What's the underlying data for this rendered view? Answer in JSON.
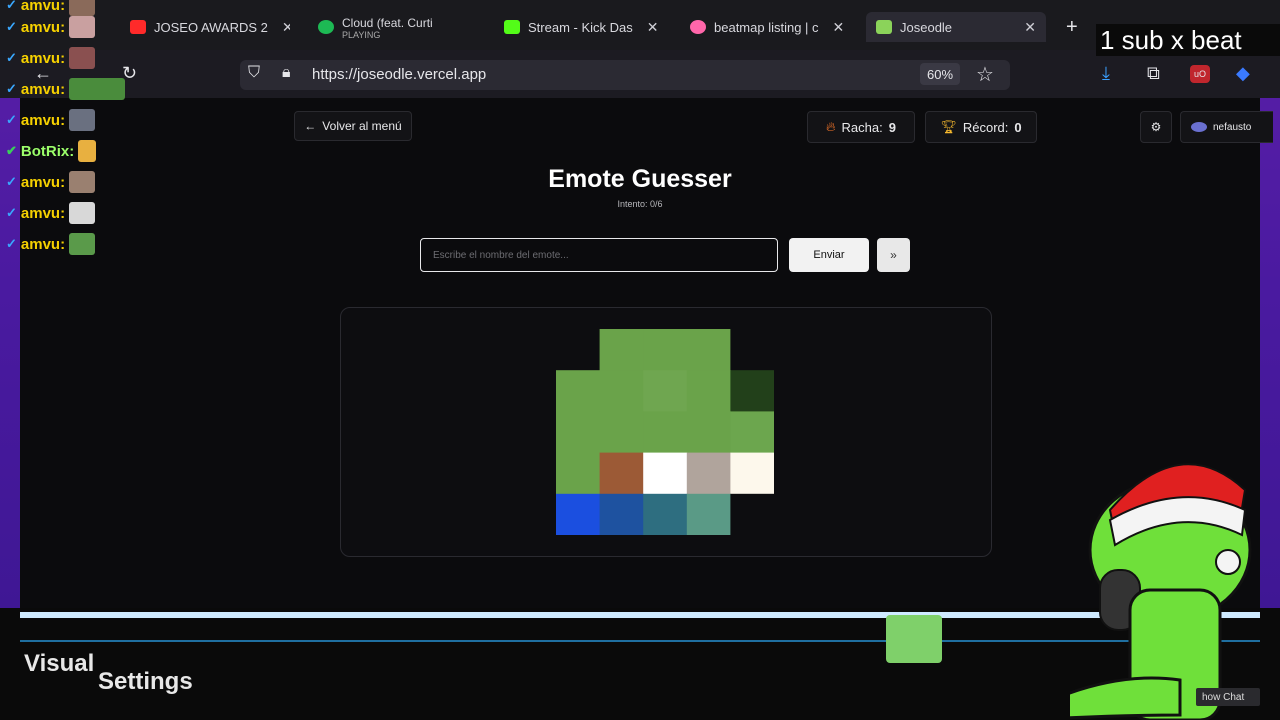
{
  "browser": {
    "tabs": [
      {
        "label": "JOSEO AWARDS 2",
        "favicon_color": "#ff2a2a"
      },
      {
        "label": "Cloud (feat. Curti",
        "sublabel": "PLAYING",
        "favicon_color": "#1db954"
      },
      {
        "label": "Stream - Kick Das",
        "favicon_color": "#53fc18"
      },
      {
        "label": "beatmap listing | c",
        "favicon_color": "#ff66aa"
      },
      {
        "label": "Joseodle",
        "favicon_color": "#8bd35a"
      }
    ],
    "url": "https://joseodle.vercel.app",
    "zoom": "60%"
  },
  "stream_overlay": {
    "banner_text": "1 sub x beat",
    "chat": [
      {
        "user": "amvu:",
        "emote_color": "#8a6a5a"
      },
      {
        "user": "amvu:",
        "emote_color": "#c9a0a0"
      },
      {
        "user": "amvu:",
        "emote_color": "#4a8c3c"
      },
      {
        "user": "amvu:",
        "emote_color": "#6a7080"
      },
      {
        "user": "BotRix:",
        "emote_color": "#e8b040",
        "bot": true
      },
      {
        "user": "amvu:",
        "emote_color": "#9a8070"
      },
      {
        "user": "amvu:",
        "emote_color": "#d8d8d8"
      },
      {
        "user": "amvu:",
        "emote_color": "#5a9a4a"
      }
    ],
    "visual_label": "Visual",
    "settings_label": "Settings",
    "show_chat_label": "how Chat"
  },
  "page": {
    "back_label": "Volver al menú",
    "streak_label": "Racha:",
    "streak_value": "9",
    "record_label": "Récord:",
    "record_value": "0",
    "user_name": "nefausto",
    "title": "Emote Guesser",
    "attempt_text": "Intento: 0/6",
    "input_placeholder": "Escribe el nombre del emote...",
    "send_label": "Enviar",
    "skip_label": "»"
  },
  "emote_pixels": [
    [
      "#0d0d10",
      "#6aa34a",
      "#6aa34a",
      "#6aa34a",
      "#0d0d10"
    ],
    [
      "#6aa34a",
      "#6aa34a",
      "#6fa650",
      "#6aa34a",
      "#22401a"
    ],
    [
      "#6aa34a",
      "#6aa34a",
      "#6aa34a",
      "#6aa34a",
      "#6ca64e"
    ],
    [
      "#6aa34a",
      "#9c5a36",
      "#ffffff",
      "#b0a49c",
      "#fdf8ec"
    ],
    [
      "#1b4fe0",
      "#1e52a0",
      "#2e6e80",
      "#5a9a86",
      "#0d0d10"
    ]
  ],
  "colors": {
    "accent_flame": "#ff7a2a",
    "accent_trophy": "#f5b82e",
    "page_bg": "#0b0b0d",
    "stream_bg": "#4a1aa0"
  }
}
